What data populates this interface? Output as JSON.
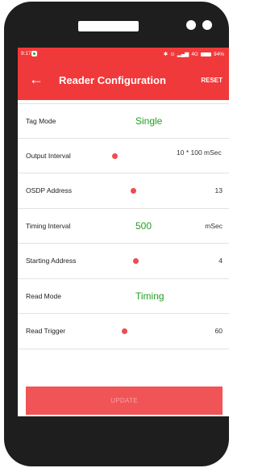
{
  "device": {
    "status_bar": {
      "time": "9:17",
      "icons": [
        "bluetooth-icon",
        "alarm-icon",
        "signal-icon",
        "4g-icon",
        "battery-icon"
      ],
      "network": "4G",
      "battery": "94%"
    }
  },
  "appbar": {
    "back_icon": "arrow-left-icon",
    "title": "Reader Configuration",
    "reset_label": "RESET"
  },
  "settings": [
    {
      "label": "Tag Mode",
      "value": "Single"
    },
    {
      "label": "Output Interval",
      "value": "10 * 100 mSec"
    },
    {
      "label": "OSDP Address",
      "value": "13"
    },
    {
      "label": "Timing Interval",
      "value": "500",
      "unit": "mSec"
    },
    {
      "label": "Starting Address",
      "value": "4"
    },
    {
      "label": "Read Mode",
      "value": "Timing"
    },
    {
      "label": "Read Trigger",
      "value": "60"
    }
  ],
  "update_label": "UPDATE",
  "colors": {
    "primary": "#f0393b",
    "accent_text": "#22a022",
    "slider_dot": "#f04a52",
    "update_button": "#f05457"
  }
}
